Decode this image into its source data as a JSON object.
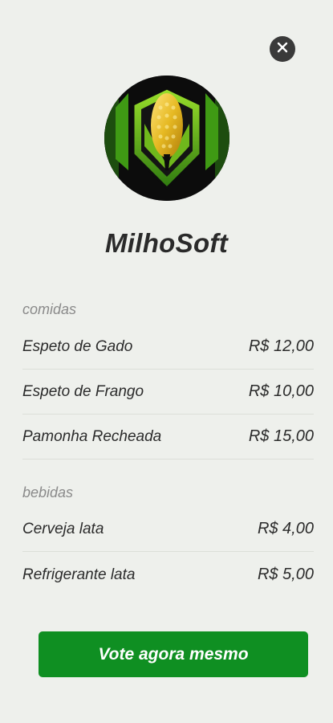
{
  "close": {
    "icon": "close-icon"
  },
  "brand": {
    "name": "MilhoSoft",
    "logo_icon": "corn-shield-logo"
  },
  "sections": [
    {
      "title": "comidas",
      "items": [
        {
          "name": "Espeto de Gado",
          "price": "R$ 12,00"
        },
        {
          "name": "Espeto de Frango",
          "price": "R$ 10,00"
        },
        {
          "name": "Pamonha Recheada",
          "price": "R$ 15,00"
        }
      ]
    },
    {
      "title": "bebidas",
      "items": [
        {
          "name": "Cerveja lata",
          "price": "R$ 4,00"
        },
        {
          "name": "Refrigerante lata",
          "price": "R$ 5,00"
        }
      ]
    }
  ],
  "cta": {
    "label": "Vote agora mesmo"
  },
  "colors": {
    "accent": "#0f8f22",
    "background": "#eef0ec"
  }
}
